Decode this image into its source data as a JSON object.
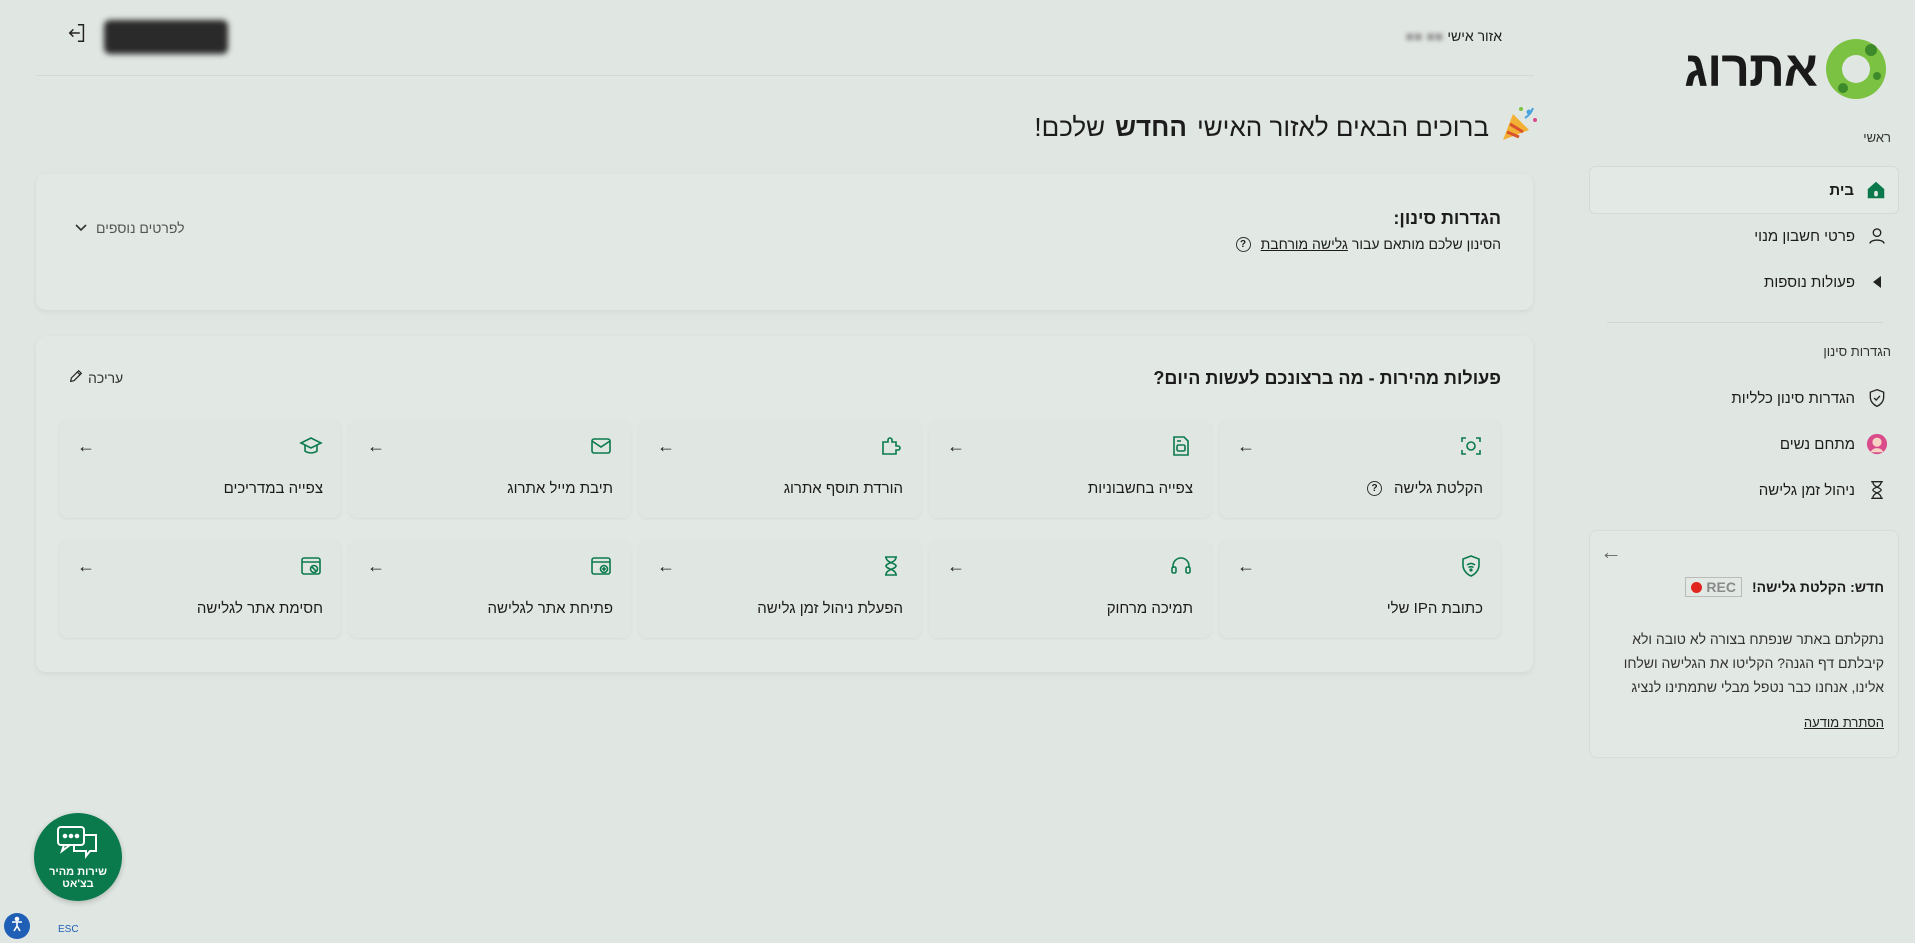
{
  "sidebar": {
    "logo_text": "אתרוג",
    "main_heading": "ראשי",
    "items": [
      {
        "label": "בית",
        "icon": "home-icon"
      },
      {
        "label": "פרטי חשבון מנוי",
        "icon": "user-icon"
      },
      {
        "label": "פעולות נוספות",
        "icon": "caret-left-icon"
      }
    ],
    "filter_heading": "הגדרות סינון",
    "filter_items": [
      {
        "label": "הגדרות סינון כלליות",
        "icon": "shield-check-icon"
      },
      {
        "label": "מתחם נשים",
        "icon": "woman-icon"
      },
      {
        "label": "ניהול זמן גלישה",
        "icon": "hourglass-icon"
      }
    ],
    "promo": {
      "rec_label": "REC",
      "title": "חדש: הקלטת גלישה!",
      "body": "נתקלתם באתר שנפתח בצורה לא טובה ולא קיבלתם דף הגנה? הקליטו את הגלישה ושלחו אלינו, אנחנו כבר נטפל מבלי שתמתינו לנציג",
      "link": "הסתרת מודעה"
    }
  },
  "topbar": {
    "user_label": "אזור אישי"
  },
  "welcome": {
    "prefix": "ברוכים הבאים לאזור האישי",
    "bold": "החדש",
    "suffix": "שלכם!"
  },
  "filter_panel": {
    "title": "הגדרות סינון:",
    "subtitle_prefix": "הסינון שלכם מותאם עבור",
    "subtitle_link": "גלישה מורחבת",
    "more_details": "לפרטים נוספים"
  },
  "actions_panel": {
    "title": "פעולות מהירות - מה ברצונכם לעשות היום?",
    "edit_label": "עריכה",
    "tiles": [
      {
        "label": "הקלטת גלישה",
        "icon": "screen-record-icon",
        "help": true
      },
      {
        "label": "צפייה בחשבוניות",
        "icon": "invoice-icon",
        "help": false
      },
      {
        "label": "הורדת תוסף אתרוג",
        "icon": "puzzle-icon",
        "help": false
      },
      {
        "label": "תיבת מייל אתרוג",
        "icon": "mail-icon",
        "help": false
      },
      {
        "label": "צפייה במדריכים",
        "icon": "graduation-cap-icon",
        "help": false
      },
      {
        "label": "כתובת הIP שלי",
        "icon": "wifi-shield-icon",
        "help": false
      },
      {
        "label": "תמיכה מרחוק",
        "icon": "headset-icon",
        "help": false
      },
      {
        "label": "הפעלת ניהול זמן גלישה",
        "icon": "hourglass-icon",
        "help": false
      },
      {
        "label": "פתיחת אתר לגלישה",
        "icon": "browser-plus-icon",
        "help": false
      },
      {
        "label": "חסימת אתר לגלישה",
        "icon": "browser-block-icon",
        "help": false
      }
    ]
  },
  "chat": {
    "label_line1": "שירות מהיר",
    "label_line2": "בצ'אט"
  },
  "accessibility": {
    "esc_label": "ESC"
  },
  "colors": {
    "accent": "#0a7a4c",
    "background": "#e0e6e2",
    "logo_green": "#7cc242"
  }
}
